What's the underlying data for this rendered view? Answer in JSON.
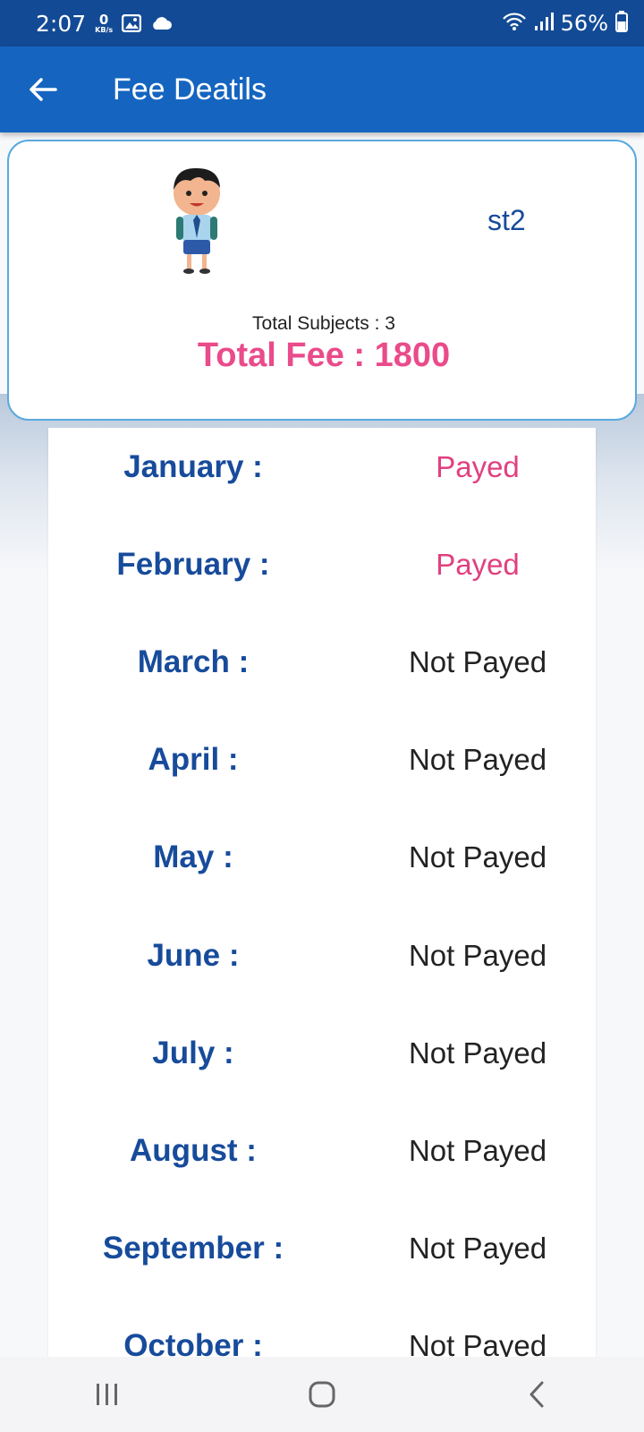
{
  "status_bar": {
    "time": "2:07",
    "data_rate_value": "0",
    "data_rate_unit": "KB/s",
    "battery": "56%"
  },
  "header": {
    "title": "Fee Deatils",
    "back_icon": "arrow-left-icon"
  },
  "profile": {
    "name": "st2",
    "avatar_icon": "student-avatar-icon",
    "total_subjects": "Total Subjects : 3",
    "total_fee": "Total Fee : 1800"
  },
  "fees": [
    {
      "month": "January :",
      "status": "Payed",
      "paid": true
    },
    {
      "month": "February :",
      "status": "Payed",
      "paid": true
    },
    {
      "month": "March :",
      "status": "Not Payed",
      "paid": false
    },
    {
      "month": "April :",
      "status": "Not Payed",
      "paid": false
    },
    {
      "month": "May :",
      "status": "Not Payed",
      "paid": false
    },
    {
      "month": "June :",
      "status": "Not Payed",
      "paid": false
    },
    {
      "month": "July :",
      "status": "Not Payed",
      "paid": false
    },
    {
      "month": "August :",
      "status": "Not Payed",
      "paid": false
    },
    {
      "month": "September :",
      "status": "Not Payed",
      "paid": false
    },
    {
      "month": "October :",
      "status": "Not Payed",
      "paid": false
    }
  ],
  "colors": {
    "app_bar": "#1565c0",
    "status_bar": "#124a96",
    "month_text": "#174b9b",
    "paid_text": "#e0407f",
    "total_fee": "#ea4b8a"
  },
  "nav": {
    "recents_icon": "recents-icon",
    "home_icon": "home-icon",
    "back_icon": "chevron-left-icon"
  }
}
